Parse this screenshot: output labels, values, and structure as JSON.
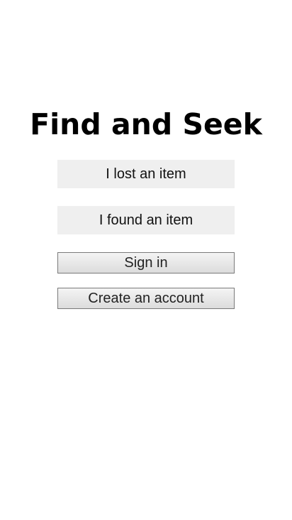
{
  "app": {
    "title": "Find and Seek"
  },
  "actions": {
    "lost_label": "I lost an item",
    "found_label": "I found an item",
    "sign_in_label": "Sign in",
    "create_account_label": "Create an account"
  }
}
